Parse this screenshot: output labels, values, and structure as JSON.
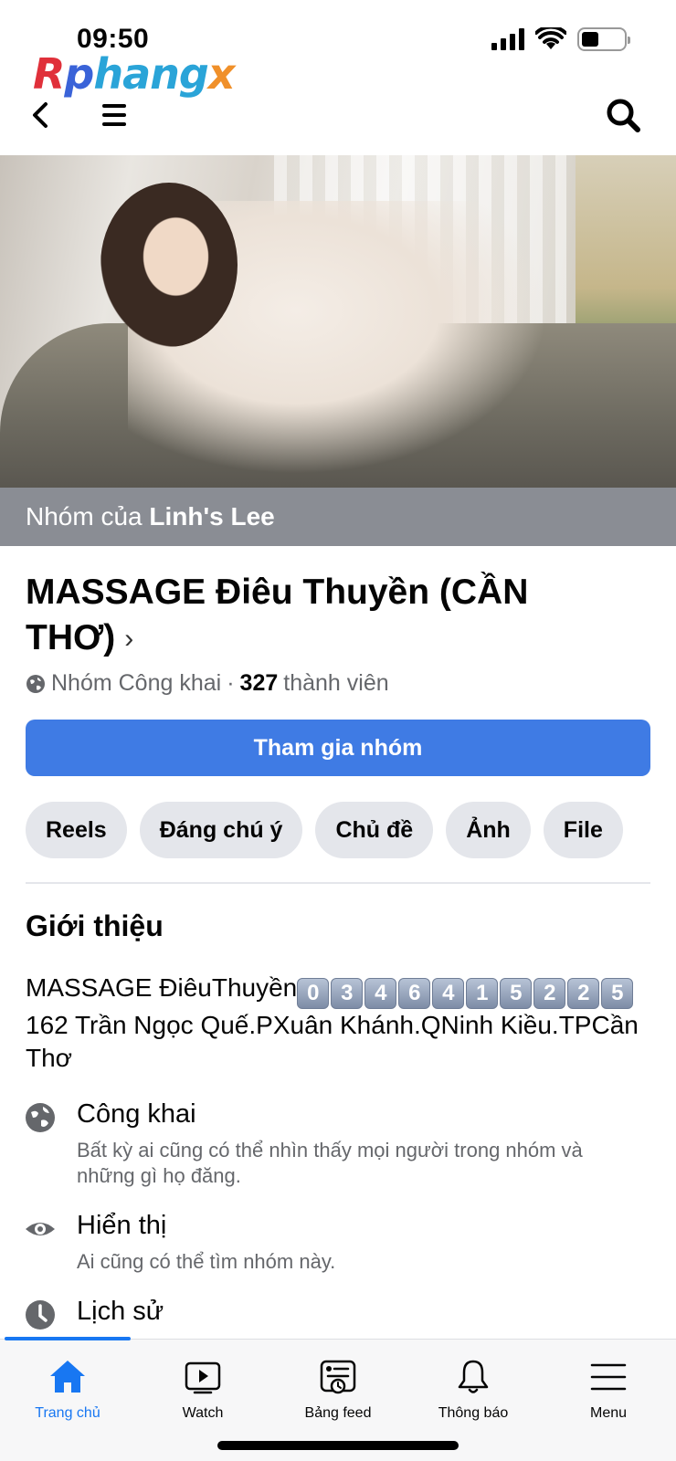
{
  "status_bar": {
    "time": "09:50"
  },
  "watermark": {
    "r": "R",
    "phang": "phang",
    "x": "x"
  },
  "cover": {
    "label_prefix": "Nhóm của",
    "owner": "Linh's Lee"
  },
  "group": {
    "title": "MASSAGE Điêu Thuyền (CẦN THƠ)",
    "privacy": "Nhóm Công khai",
    "separator": "·",
    "member_count": "327",
    "member_label": "thành viên",
    "join_button": "Tham gia nhóm"
  },
  "chips": [
    "Reels",
    "Đáng chú ý",
    "Chủ đề",
    "Ảnh",
    "File"
  ],
  "about": {
    "title": "Giới thiệu",
    "intro_prefix": "MASSAGE ĐiêuThuyền",
    "phone_digits": [
      "0",
      "3",
      "4",
      "6",
      "4",
      "1",
      "5",
      "2",
      "2",
      "5"
    ],
    "intro_address": " 162 Trần Ngọc Quế.PXuân Khánh.QNinh Kiều.TPCần Thơ",
    "items": [
      {
        "title": "Công khai",
        "subtitle": "Bất kỳ ai cũng có thể nhìn thấy mọi người trong nhóm và những gì họ đăng.",
        "icon": "globe-icon"
      },
      {
        "title": "Hiển thị",
        "subtitle": "Ai cũng có thể tìm nhóm này.",
        "icon": "eye-icon"
      },
      {
        "title": "Lịch sử",
        "subtitle": "",
        "icon": "clock-icon"
      }
    ]
  },
  "tabs": [
    {
      "label": "Trang chủ",
      "icon": "home-icon",
      "active": true
    },
    {
      "label": "Watch",
      "icon": "watch-icon",
      "active": false
    },
    {
      "label": "Bảng feed",
      "icon": "feed-icon",
      "active": false
    },
    {
      "label": "Thông báo",
      "icon": "bell-icon",
      "active": false
    },
    {
      "label": "Menu",
      "icon": "menu-icon",
      "active": false
    }
  ],
  "colors": {
    "primary": "#1877f2",
    "join_button": "#3f7be4",
    "chip_bg": "#e4e6eb",
    "cover_label_bg": "#8a8d94"
  }
}
